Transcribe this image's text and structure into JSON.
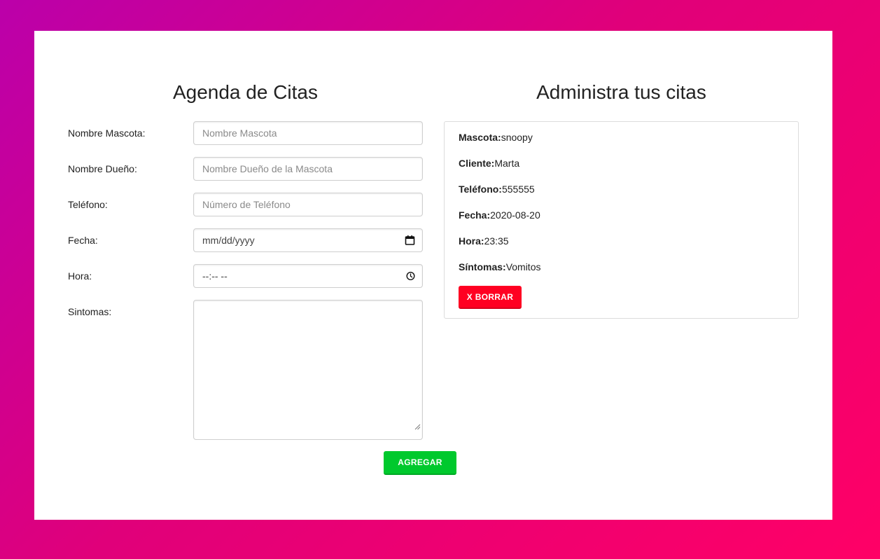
{
  "form": {
    "title": "Agenda de Citas",
    "fields": [
      {
        "label": "Nombre Mascota:",
        "placeholder": "Nombre Mascota"
      },
      {
        "label": "Nombre Dueño:",
        "placeholder": "Nombre Dueño de la Mascota"
      },
      {
        "label": "Teléfono:",
        "placeholder": "Número de Teléfono"
      },
      {
        "label": "Fecha:",
        "value": "mm/dd/yyyy",
        "icon": "calendar-icon"
      },
      {
        "label": "Hora:",
        "value": "--:-- --",
        "icon": "clock-icon"
      },
      {
        "label": "Sintomas:",
        "value": ""
      }
    ],
    "submit_label": "AGREGAR"
  },
  "list": {
    "title": "Administra tus citas",
    "appointments": [
      {
        "mascota_label": "Mascota:",
        "mascota": "snoopy",
        "cliente_label": "Cliente:",
        "cliente": "Marta",
        "telefono_label": "Teléfono:",
        "telefono": "555555",
        "fecha_label": "Fecha:",
        "fecha": "2020-08-20",
        "hora_label": "Hora:",
        "hora": "23:35",
        "sintomas_label": "Síntomas:",
        "sintomas": "Vomitos",
        "delete_label": "X BORRAR"
      }
    ]
  },
  "colors": {
    "background_gradient": [
      "#bb00aa",
      "#ff0066"
    ],
    "add_button": "#00c92d",
    "delete_button": "#ff0022",
    "card": "#ffffff"
  }
}
